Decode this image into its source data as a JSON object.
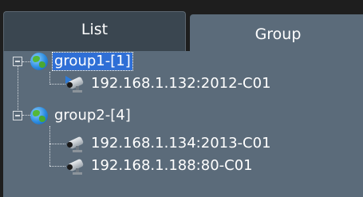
{
  "tabs": [
    {
      "label": "List",
      "active": false
    },
    {
      "label": "Group",
      "active": true
    }
  ],
  "tree": {
    "groups": [
      {
        "label": "group1-[1]",
        "icon": "globe-icon",
        "expanded": true,
        "selected": true,
        "devices": [
          {
            "label": "192.168.1.132:2012-C01",
            "icon": "camera-playing-icon"
          }
        ]
      },
      {
        "label": "group2-[4]",
        "icon": "globe-icon",
        "expanded": true,
        "selected": false,
        "devices": [
          {
            "label": "192.168.1.134:2013-C01",
            "icon": "camera-icon"
          },
          {
            "label": "192.168.1.188:80-C01",
            "icon": "camera-icon"
          }
        ]
      }
    ]
  },
  "colors": {
    "panel_bg": "#5b6b7a",
    "inactive_tab_bg": "#3a4650",
    "selection_bg": "#2f6fd6",
    "text": "#ffffff"
  }
}
